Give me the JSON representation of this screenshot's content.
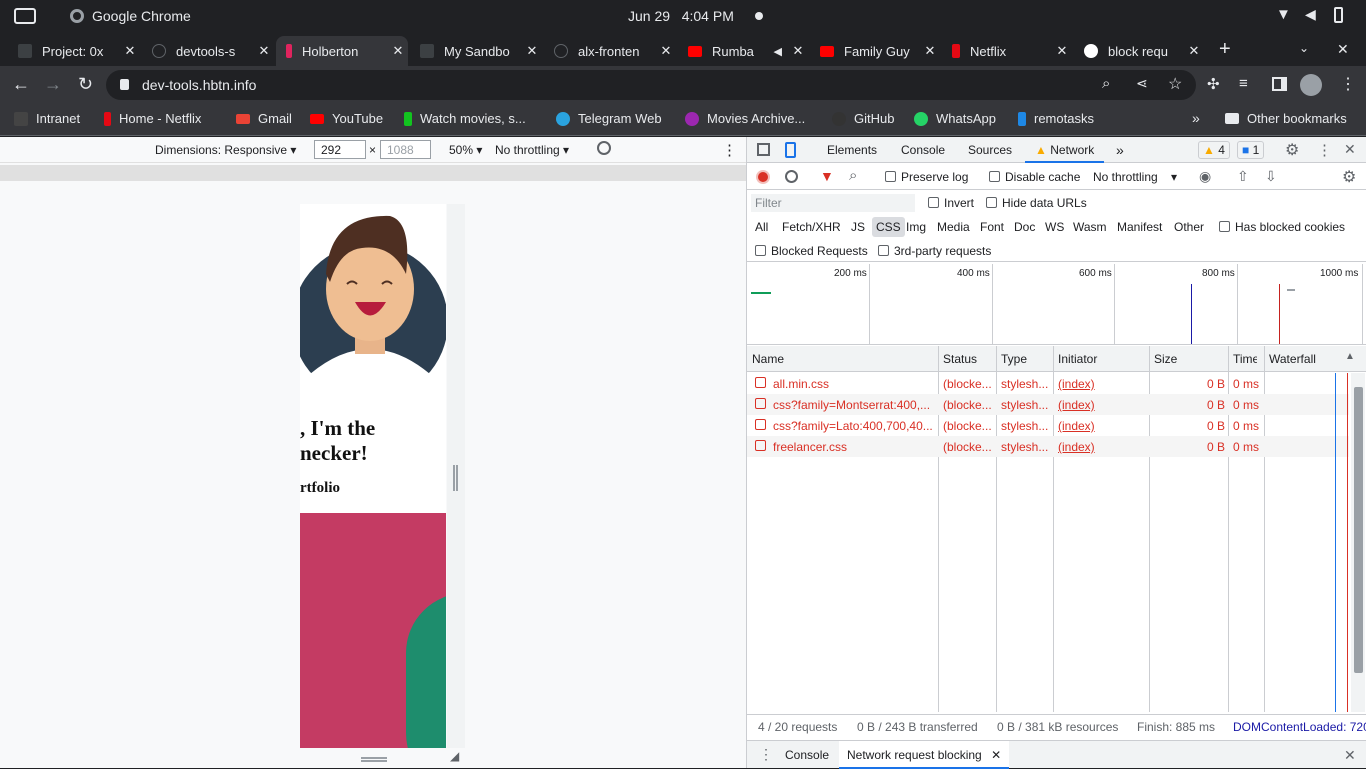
{
  "os": {
    "app_title": "Google Chrome",
    "date": "Jun 29",
    "time": "4:04 PM"
  },
  "tabs": [
    {
      "label": "Project: 0x",
      "active": false
    },
    {
      "label": "devtools-s",
      "active": false
    },
    {
      "label": "Holberton",
      "active": true
    },
    {
      "label": "My Sandbo",
      "active": false
    },
    {
      "label": "alx-fronten",
      "active": false
    },
    {
      "label": "Rumba",
      "active": false
    },
    {
      "label": "Family Guy",
      "active": false
    },
    {
      "label": "Netflix",
      "active": false
    },
    {
      "label": "block requ",
      "active": false
    }
  ],
  "address": {
    "url": "dev-tools.hbtn.info"
  },
  "bookmarks": [
    {
      "label": "Intranet",
      "color": "#444"
    },
    {
      "label": "Home - Netflix",
      "color": "#e50914"
    },
    {
      "label": "Gmail",
      "color": "#ea4335"
    },
    {
      "label": "YouTube",
      "color": "#ff0000"
    },
    {
      "label": "Watch movies, s...",
      "color": "#12c41f"
    },
    {
      "label": "Telegram Web",
      "color": "#2aa3df"
    },
    {
      "label": "Movies Archive...",
      "color": "#9c27b0"
    },
    {
      "label": "GitHub",
      "color": "#333"
    },
    {
      "label": "WhatsApp",
      "color": "#25d366"
    },
    {
      "label": "remotasks",
      "color": "#1e88e5"
    }
  ],
  "other_bookmarks": "Other bookmarks",
  "device_toolbar": {
    "dimensions": "Dimensions: Responsive",
    "width": "292",
    "times": "×",
    "height_placeholder": "1088",
    "zoom": "50%",
    "throttling": "No throttling"
  },
  "page_preview": {
    "heading_line1": ", I'm the",
    "heading_line2": "necker!",
    "subheading": "rtfolio"
  },
  "devtools": {
    "panels": [
      "Elements",
      "Console",
      "Sources",
      "Network"
    ],
    "active_panel": "Network",
    "warnings": "4",
    "messages": "1",
    "preserve_log": "Preserve log",
    "disable_cache": "Disable cache",
    "throttling": "No throttling",
    "filter_placeholder": "Filter",
    "invert": "Invert",
    "hide_data_urls": "Hide data URLs",
    "types": [
      "All",
      "Fetch/XHR",
      "JS",
      "CSS",
      "Img",
      "Media",
      "Font",
      "Doc",
      "WS",
      "Wasm",
      "Manifest",
      "Other"
    ],
    "active_type": "CSS",
    "has_blocked_cookies": "Has blocked cookies",
    "blocked_requests": "Blocked Requests",
    "third_party": "3rd-party requests",
    "timeline_ticks": [
      "200 ms",
      "400 ms",
      "600 ms",
      "800 ms",
      "1000 ms"
    ],
    "columns": [
      "Name",
      "Status",
      "Type",
      "Initiator",
      "Size",
      "Time",
      "Waterfall"
    ],
    "rows": [
      {
        "name": "all.min.css",
        "status": "(blocke...",
        "type": "stylesh...",
        "initiator": "(index)",
        "size": "0 B",
        "time": "0 ms"
      },
      {
        "name": "css?family=Montserrat:400,...",
        "status": "(blocke...",
        "type": "stylesh...",
        "initiator": "(index)",
        "size": "0 B",
        "time": "0 ms"
      },
      {
        "name": "css?family=Lato:400,700,40...",
        "status": "(blocke...",
        "type": "stylesh...",
        "initiator": "(index)",
        "size": "0 B",
        "time": "0 ms"
      },
      {
        "name": "freelancer.css",
        "status": "(blocke...",
        "type": "stylesh...",
        "initiator": "(index)",
        "size": "0 B",
        "time": "0 ms"
      }
    ],
    "status_bar": {
      "requests": "4 / 20 requests",
      "transferred": "0 B / 243 B transferred",
      "resources": "0 B / 381 kB resources",
      "finish": "Finish: 885 ms",
      "dcl": "DOMContentLoaded: 720"
    },
    "drawer_tabs": [
      "Console",
      "Network request blocking"
    ]
  }
}
